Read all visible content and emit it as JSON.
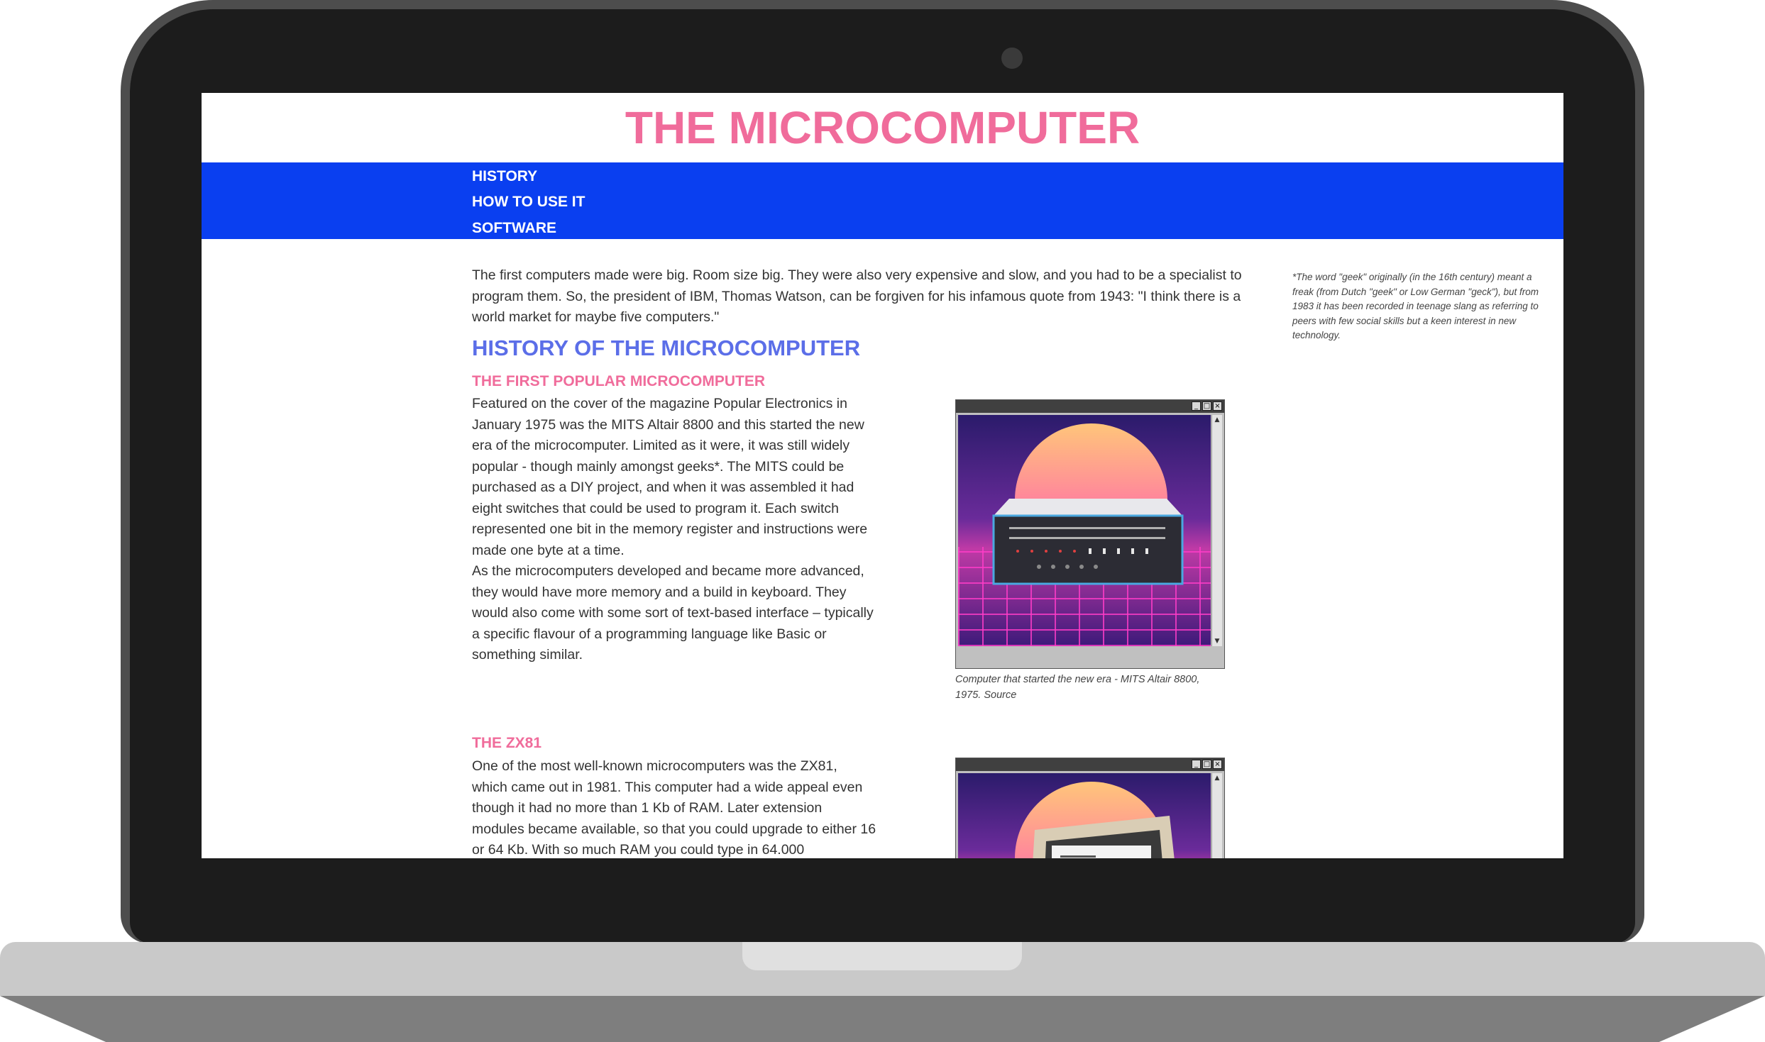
{
  "site": {
    "title": "THE MICROCOMPUTER"
  },
  "nav": {
    "items": [
      {
        "label": "HISTORY"
      },
      {
        "label": "HOW TO USE IT"
      },
      {
        "label": "SOFTWARE"
      }
    ]
  },
  "content": {
    "intro": "The first computers made were big. Room size big. They were also very expensive and slow, and you had to be a specialist to program them. So, the president of IBM, Thomas Watson, can be forgiven for his infamous quote from 1943: \"I think there is a world market for maybe five computers.\"",
    "aside_note": "*The word \"geek\" originally (in the 16th century) meant a freak (from Dutch \"geek\" or Low German \"geck\"), but from 1983 it has been recorded in teenage slang as referring to peers with few social skills but a keen interest in new technology.",
    "history_heading": "HISTORY OF THE MICROCOMPUTER",
    "sections": [
      {
        "heading": "THE FIRST POPULAR MICROCOMPUTER",
        "paragraphs": [
          "Featured on the cover of the magazine Popular Electronics in January 1975 was the MITS Altair 8800 and this started the new era of the microcomputer. Limited as it were, it was still widely popular - though mainly amongst geeks*. The MITS could be purchased as a DIY project, and when it was assembled it had eight switches that could be used to program it. Each switch represented one bit in the memory register and instructions were made one byte at a time.",
          "As the microcomputers developed and became more advanced, they would have more memory and a build in keyboard. They would also come with some sort of text-based interface – typically a specific flavour of a programming language like Basic or something similar."
        ],
        "caption": "Computer that started the new era - MITS Altair 8800, 1975.",
        "caption_link": "Source"
      },
      {
        "heading": "THE ZX81",
        "paragraphs": [
          "One of the most well-known microcomputers was the ZX81, which came out in 1981. This computer had a wide appeal even though it had no more than 1 Kb of RAM. Later extension modules became available, so that you could upgrade to either 16 or 64 Kb. With so much RAM you could type in 64.000"
        ]
      }
    ]
  },
  "window_controls": {
    "minimize": "_",
    "maximize": "□",
    "close": "×",
    "scroll_up": "▲",
    "scroll_down": "▼"
  },
  "colors": {
    "title": "#f06c9b",
    "nav_bg": "#0a3ff0",
    "h2": "#5b6ee8",
    "h3": "#f06c9b"
  }
}
